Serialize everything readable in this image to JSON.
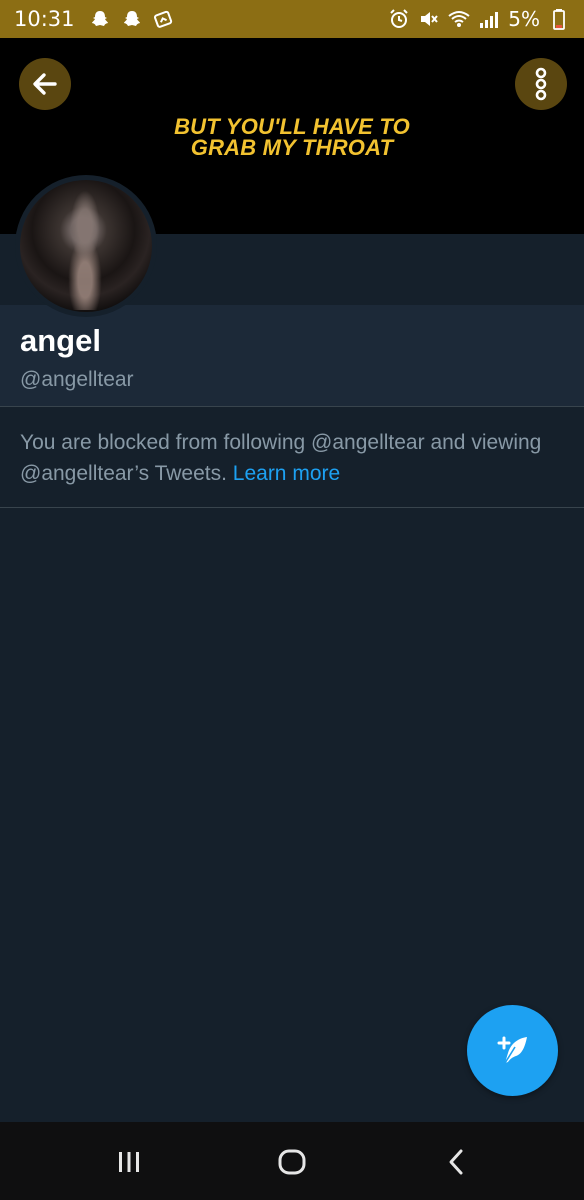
{
  "status_bar": {
    "time": "10:31",
    "battery": "5%",
    "left_icons": [
      "snapchat-icon",
      "snapchat-icon",
      "gallery-icon"
    ],
    "right_icons": [
      "alarm-icon",
      "mute-icon",
      "wifi-icon",
      "signal-icon",
      "battery-icon"
    ]
  },
  "header": {
    "banner_line1": "BUT YOU'LL HAVE TO",
    "banner_line2": "GRAB MY THROAT",
    "banner_color": "#f2c230"
  },
  "profile": {
    "display_name": "angel",
    "handle": "@angelltear"
  },
  "blocked": {
    "message": "You are blocked from following @angelltear and viewing @angelltear’s Tweets.",
    "link": "Learn more"
  },
  "colors": {
    "background": "#15202b",
    "accent": "#1da1f2",
    "status_bar": "#8c6e14"
  },
  "icons": {
    "back": "back-arrow-icon",
    "more": "more-vertical-icon",
    "compose": "compose-tweet-icon",
    "nav_recents": "recents-icon",
    "nav_home": "home-icon",
    "nav_back": "nav-back-icon"
  }
}
